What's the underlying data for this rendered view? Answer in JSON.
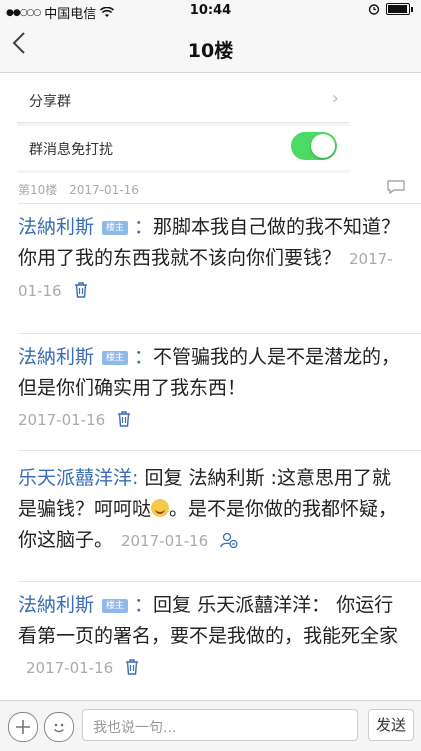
{
  "status_bar": {
    "carrier": "中国电信",
    "time": "10:44",
    "signal_dots": "●●○○○"
  },
  "nav": {
    "title": "10楼"
  },
  "embedded_settings": {
    "share_group_label": "分享群",
    "mute_label": "群消息免打扰",
    "mute_enabled": true
  },
  "floor": {
    "label": "第10楼",
    "date": "2017-01-16"
  },
  "replies": [
    {
      "author": "法納利斯",
      "badge": "楼主",
      "colon": "：",
      "text": "那脚本我自己做的我不知道？你用了我的东西我就不该向你们要钱？",
      "date": "2017-01-16",
      "action_icon": "trash-icon"
    },
    {
      "author": "法納利斯",
      "badge": "楼主",
      "colon": "：",
      "text": "不管骗我的人是不是潜龙的，但是你们确实用了我东西！",
      "date": "2017-01-16",
      "action_icon": "trash-icon"
    },
    {
      "author": "乐天派囍洋洋",
      "colon": ":",
      "text_before": " 回复 法納利斯 :这意思用了就是骗钱？呵呵哒",
      "text_after": "。是不是你做的我都怀疑，你这脑子。",
      "date": "2017-01-16",
      "action_icon": "reply-user-icon"
    },
    {
      "author": "法納利斯",
      "badge": "楼主",
      "colon": "：",
      "text": "回复 乐天派囍洋洋： 你运行看第一页的署名，要不是我做的，我能死全家",
      "date": "2017-01-16",
      "action_icon": "trash-icon"
    }
  ],
  "bottom_bar": {
    "input_placeholder": "我也说一句...",
    "send_label": "发送"
  },
  "colors": {
    "author": "#3a6db5",
    "toggle_on": "#4cd964",
    "badge": "#8fb9e8"
  }
}
